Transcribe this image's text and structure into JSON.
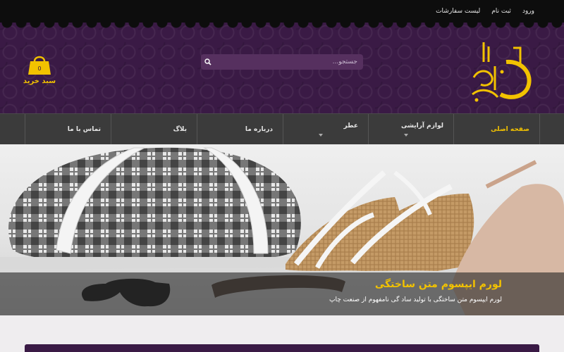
{
  "top_links": [
    {
      "label": "ورود"
    },
    {
      "label": "ثبت نام"
    },
    {
      "label": "لیست سفارشات"
    }
  ],
  "search": {
    "placeholder": "جستجو..."
  },
  "cart": {
    "label": "سبد خرید",
    "count": "0"
  },
  "nav": {
    "items": [
      {
        "label": "صفحه اصلی",
        "active": true,
        "dropdown": false
      },
      {
        "label": "لوازم آرایشی",
        "active": false,
        "dropdown": true
      },
      {
        "label": "عطر",
        "active": false,
        "dropdown": true
      },
      {
        "label": "درباره ما",
        "active": false,
        "dropdown": false
      },
      {
        "label": "بلاگ",
        "active": false,
        "dropdown": false
      },
      {
        "label": "تماس با ما",
        "active": false,
        "dropdown": false
      }
    ]
  },
  "banner": {
    "title": "لورم ایپسوم متن ساختگی",
    "subtitle": "لورم ایپسوم متن ساختگی با تولید ساد گی نامفهوم از صنعت چاپ"
  },
  "colors": {
    "accent": "#f2c200",
    "header": "#3a1a45",
    "nav": "#3b3b3b"
  }
}
